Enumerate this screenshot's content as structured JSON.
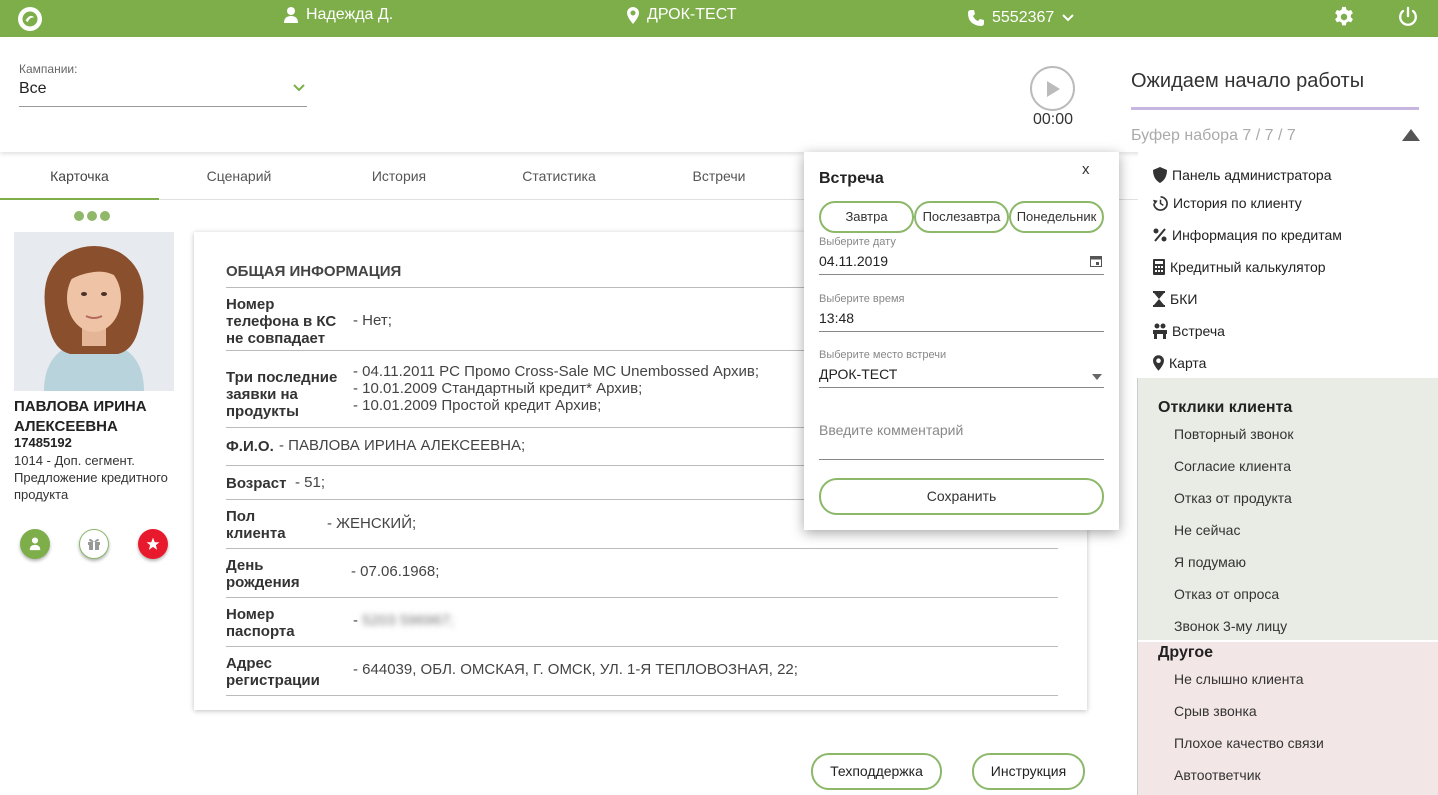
{
  "topbar": {
    "user": "Надежда Д.",
    "location": "ДРОК-ТЕСТ",
    "phone": "5552367",
    "icons": [
      "logo-icon",
      "user-icon",
      "map-pin-icon",
      "phone-icon",
      "chevron-down-icon",
      "gear-icon",
      "power-icon"
    ]
  },
  "header": {
    "campaign_label": "Кампании:",
    "campaign_value": "Все",
    "timer": "00:00",
    "status_title": "Ожидаем начало работы",
    "buffer": "Буфер набора 7 / 7 / 7"
  },
  "tabs": [
    "Карточка",
    "Сценарий",
    "История",
    "Статистика",
    "Встречи"
  ],
  "profile": {
    "name": "ПАВЛОВА ИРИНА АЛЕКСЕЕВНА",
    "id": "17485192",
    "segment": "1014 - Доп. сегмент. Предложение кредитного продукта"
  },
  "card": {
    "title": "ОБЩАЯ ИНФОРМАЦИЯ",
    "rows": [
      {
        "label": "Номер телефона в КС не совпадает",
        "value": "- Нет;"
      },
      {
        "label": "Три последние заявки на продукты",
        "value": "- 04.11.2011 PC Промо Cross-Sale MC Unembossed Архив;\n- 10.01.2009 Стандартный кредит* Архив;\n- 10.01.2009 Простой кредит Архив;"
      },
      {
        "label": "Ф.И.О.",
        "value": "- ПАВЛОВА ИРИНА АЛЕКСЕЕВНА;"
      },
      {
        "label": "Возраст",
        "value": "- 51;"
      },
      {
        "label": "Пол клиента",
        "value": "- ЖЕНСКИЙ;"
      },
      {
        "label": "День рождения",
        "value": "- 07.06.1968;"
      },
      {
        "label": "Номер паспорта",
        "value": "- 5203 596967;"
      },
      {
        "label": "Адрес регистрации",
        "value": "- 644039, ОБЛ. ОМСКАЯ, Г. ОМСК, УЛ. 1-Я ТЕПЛОВОЗНАЯ, 22;"
      }
    ]
  },
  "popup": {
    "title": "Встреча",
    "close": "x",
    "quick": [
      "Завтра",
      "Послезавтра",
      "Понедельник"
    ],
    "date_label": "Выберите дату",
    "date_value": "04.11.2019",
    "time_label": "Выберите время",
    "time_value": "13:48",
    "place_label": "Выберите место встречи",
    "place_value": "ДРОК-ТЕСТ",
    "comment_placeholder": "Введите комментарий",
    "save": "Сохранить"
  },
  "side_menu": [
    {
      "label": "Панель администратора",
      "icon": "shield-icon"
    },
    {
      "label": "История по клиенту",
      "icon": "history-icon"
    },
    {
      "label": "Информация по кредитам",
      "icon": "percent-icon"
    },
    {
      "label": "Кредитный калькулятор",
      "icon": "calculator-icon"
    },
    {
      "label": "БКИ",
      "icon": "hourglass-icon"
    },
    {
      "label": "Встреча",
      "icon": "meeting-icon"
    },
    {
      "label": "Карта",
      "icon": "map-pin-icon"
    }
  ],
  "responses": {
    "title": "Отклики клиента",
    "items": [
      "Повторный звонок",
      "Согласие клиента",
      "Отказ от продукта",
      "Не сейчас",
      "Я подумаю",
      "Отказ от опроса",
      "Звонок 3-му лицу"
    ]
  },
  "other": {
    "title": "Другое",
    "items": [
      "Не слышно клиента",
      "Срыв звонка",
      "Плохое качество связи",
      "Автоответчик"
    ]
  },
  "bottom": {
    "support": "Техподдержка",
    "instruction": "Инструкция"
  },
  "colors": {
    "accent": "#7dae4a",
    "responses_bg": "#e9ece5",
    "other_bg": "#f3e6e6",
    "danger": "#e8192c"
  }
}
